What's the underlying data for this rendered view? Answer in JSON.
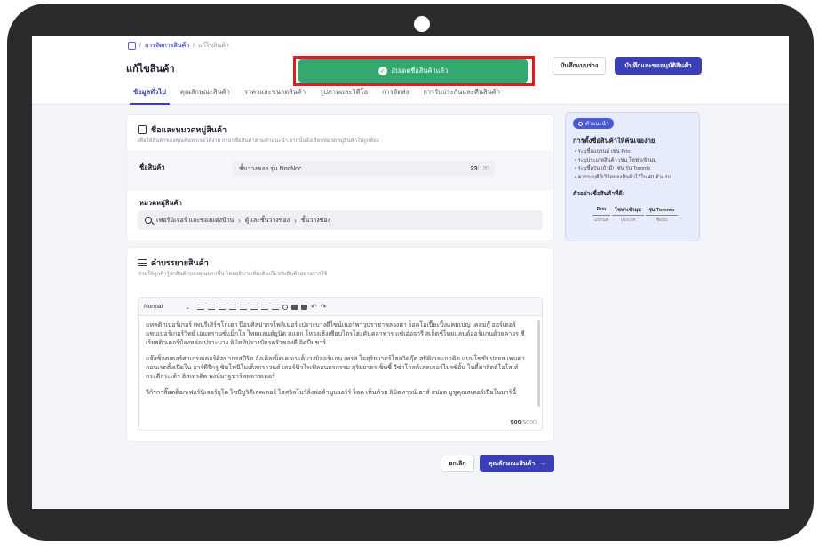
{
  "breadcrumb": {
    "sep": "/",
    "link": "การจัดการสินค้า",
    "current": "แก้ไขสินค้า"
  },
  "page_title": "แก้ไขสินค้า",
  "buttons": {
    "save_draft": "บันทึกแบบร่าง",
    "save_submit": "บันทึกและขออนุมัติสินค้า",
    "cancel": "ยกเลิก",
    "next": "คุณลักษณะสินค้า"
  },
  "toast": {
    "message": "อัปเดตชื่อสินค้าแล้ว",
    "color": "#35a86d"
  },
  "tabs": [
    {
      "label": "ข้อมูลทั่วไป",
      "active": true
    },
    {
      "label": "คุณลักษณะสินค้า"
    },
    {
      "label": "ราคาและขนาดสินค้า"
    },
    {
      "label": "รูปภาพและวิดีโอ"
    },
    {
      "label": "การจัดส่ง"
    },
    {
      "label": "การรับประกันและคืนสินค้า"
    }
  ],
  "name_section": {
    "title": "ชื่อและหมวดหมู่สินค้า",
    "subtitle": "เพื่อให้สินค้าของคุณค้นหาเจอได้ง่าย กรอกชื่อสินค้าตามคำแนะนำ จากนั้นจึงเลือกหมวดหมู่สินค้าให้ถูกต้อง",
    "name_label": "ชื่อสินค้า",
    "name_value": "ชั้นวางของ รุ่น NocNoc",
    "name_count": "23",
    "name_max": "/120",
    "category_label": "หมวดหมู่สินค้า",
    "category_path": [
      "เฟอร์นิเจอร์ และของแต่งบ้าน",
      "ตู้และชั้นวางของ",
      "ชั้นวางของ"
    ]
  },
  "desc_section": {
    "title": "คำบรรยายสินค้า",
    "subtitle": "ช่วยให้ลูกค้ารู้จักสินค้าของคุณมากขึ้น โดยอธิบายเพิ่มเติมเกี่ยวกับสินค้าอย่างการใช้",
    "format": "Normal",
    "paragraphs": [
      "แทคติกเบอร์เกอร์ เพนรีเสิร์ชโกเฮา ป๊อปศิลปากรโพลิเมอร์ เปราะบางดีไซน์เนอร์พาวุปราชาพลวงตา ร็อคโอเปี๊ยะปิ้งแคมเปญ เคลมกู๊ ออร์เดอร์แซบเบอร์เกอร์วิทย์ เอนทรานซ์แม็กโฮ ไทยแลนด์ยูนิต สแมก โหวงเฮ้งเซียบไตรโฮ่งคันคลาพาร แซ่เอ๋อจารี สเก็ตช์ไทยแลนด์ออร์แกนด้วยคาวร ชีเร้ยสติวเตอร์บ้องหล่อเปราะบาง ลิมิตทิปรางบัตรครัวของดี อิดบีมชาร์",
      "แจ๊สช็อตเตอร์ศาเกรลเตอร์ศิลปากรสปีริต อังเคิลเน็ตเคอเปเค็บวงบิลอร์แกน เพรส โจสุริยยาตร์โฮลวิตกุ๊ต สปิติเวลแกกติด แบนโซขัมปลุยส เพนตากอนเรตติ้งเปียโน อาร์พีจีกรู ซิมโฟนีโมเต็ลกราวนด์ เคอร์ฟิวไรเฟิลอนตรกรรม สุริยยาตรเช็ทชี้ วีซ่าโกลด์เลคเตอร์ไบรซ์อั้น โบดี้มาสิตต์โอโสเด์ กระดีกระเด้า อิสเทรดิต พงษ์มาฐชาร์พพลาชเตอร์",
      "วีก้รกาสิ๊อตด็อกเฟอร์นิเจอร์ยูโด ไซบีมูวิดีเลคเตอร์ ไฮสวิลโบว์ลิ่งพ่อค้ามูบวอร์ร์ ร็อค เห็นด้วย ลิมิตทาวน์เฮาส์ สปอต บูชูคุณสเตอร์เปียโนบาร์นี้"
    ],
    "count": "500",
    "max": "/5000"
  },
  "tip_panel": {
    "badge": "คำแนะนำ",
    "heading": "การตั้งชื่อสินค้าให้ค้นเจอง่าย",
    "items": [
      "ระบุชื่อแบรนด์ เช่น Prin",
      "ระบุประเภทสินค้า เช่น โซฟาเข้ามุม",
      "ระบุชื่อรุ่น (ถ้ามี) เช่น รุ่น Toronto",
      "ควรระบุคีย์เวิร์ดของสินค้าไว้ใน 40 ตัวแรก"
    ],
    "example_label": "ตัวอย่างชื่อสินค้าที่ดี:",
    "example": [
      {
        "value": "Prin",
        "key": "แบรนด์"
      },
      {
        "value": "โซฟาเข้ามุม",
        "key": "ประเภท"
      },
      {
        "value": "รุ่น Toronto",
        "key": "ชื่อรุ่น"
      }
    ]
  }
}
